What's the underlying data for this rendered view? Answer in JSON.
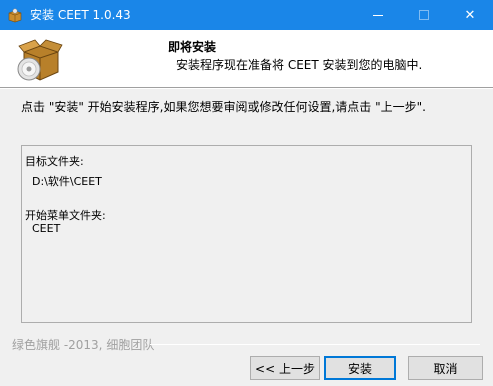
{
  "window": {
    "title": "安装 CEET 1.0.43",
    "close_glyph": "✕"
  },
  "header": {
    "title": "即将安装",
    "subtitle": "安装程序现在准备将 CEET 安装到您的电脑中."
  },
  "instruction": "点击 \"安装\" 开始安装程序,如果您想要审阅或修改任何设置,请点击 \"上一步\".",
  "info": {
    "dest_label": "目标文件夹:",
    "dest_value": "D:\\软件\\CEET",
    "menu_label": "开始菜单文件夹:",
    "menu_value": "CEET"
  },
  "footer": {
    "brand": "绿色旗舰 -2013, 细胞团队"
  },
  "buttons": {
    "back": "<< 上一步",
    "install": "安装",
    "cancel": "取消"
  },
  "colors": {
    "titlebar": "#1a86e8",
    "header_bg": "#ffffff",
    "dialog_bg": "#f0f0f0",
    "default_button_border": "#0078d7"
  },
  "icons": {
    "app": "installer-box-icon",
    "header": "installer-box-disc-icon"
  }
}
